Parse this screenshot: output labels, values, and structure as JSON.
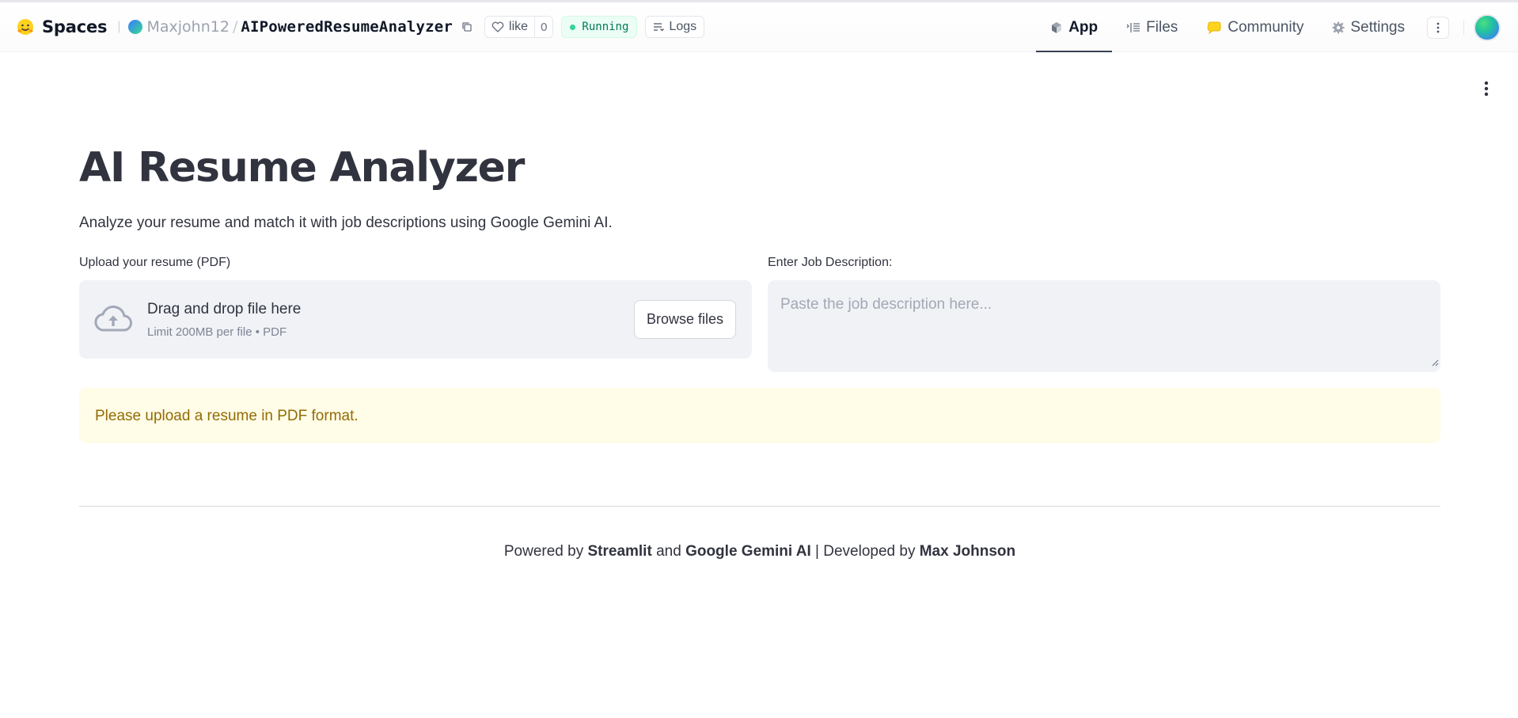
{
  "header": {
    "brand": "Spaces",
    "owner": "Maxjohn12",
    "separator": "/",
    "repo": "AIPoweredResumeAnalyzer",
    "like_label": "like",
    "like_count": "0",
    "status": "Running",
    "logs_label": "Logs",
    "tabs": [
      {
        "label": "App",
        "icon": "cube-icon",
        "active": true
      },
      {
        "label": "Files",
        "icon": "files-icon",
        "active": false
      },
      {
        "label": "Community",
        "icon": "community-icon",
        "active": false
      },
      {
        "label": "Settings",
        "icon": "gear-icon",
        "active": false
      }
    ]
  },
  "app": {
    "title": "AI Resume Analyzer",
    "subtitle": "Analyze your resume and match it with job descriptions using Google Gemini AI.",
    "uploader": {
      "label": "Upload your resume (PDF)",
      "drop_text": "Drag and drop file here",
      "limit_text": "Limit 200MB per file • PDF",
      "browse_label": "Browse files"
    },
    "job_description": {
      "label": "Enter Job Description:",
      "placeholder": "Paste the job description here..."
    },
    "warning": "Please upload a resume in PDF format.",
    "footer": {
      "powered_by": "Powered by ",
      "streamlit": "Streamlit",
      "and": " and ",
      "gemini": "Google Gemini AI",
      "developed_by": " | Developed by ",
      "author": "Max Johnson"
    }
  },
  "colors": {
    "running_text": "#047857",
    "running_bg": "#ecfdf5",
    "warning_bg": "#fffce7",
    "warning_text": "#926c05",
    "input_bg": "#f0f2f6"
  }
}
